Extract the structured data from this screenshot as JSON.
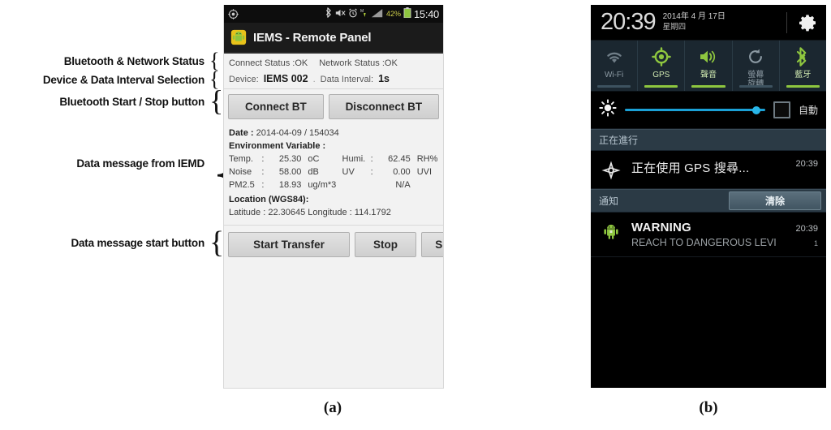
{
  "figure": {
    "caption_a": "(a)",
    "caption_b": "(b)"
  },
  "annotations": [
    {
      "id": "bt-network-status",
      "text": "Bluetooth & Network Status"
    },
    {
      "id": "device-interval",
      "text": "Device & Data Interval Selection"
    },
    {
      "id": "bt-start-stop",
      "text": "Bluetooth Start / Stop button"
    },
    {
      "id": "data-message",
      "text": "Data message from IEMD"
    },
    {
      "id": "data-start-button",
      "text": "Data message start button"
    }
  ],
  "panel_a": {
    "status_bar": {
      "icons": [
        "gps-icon",
        "bluetooth-icon",
        "mute-icon",
        "alarm-icon",
        "sync-icon",
        "signal-icon"
      ],
      "battery_percent": "42%",
      "clock": "15:40"
    },
    "action_bar": {
      "app_icon": "android-robot-icon",
      "title": "IEMS - Remote Panel"
    },
    "status_row": {
      "connect_status": "Connect Status :OK",
      "network_status": "Network Status :OK"
    },
    "device_row": {
      "device_label": "Device:",
      "device_value": "IEMS 002",
      "separator": ".",
      "interval_label": "Data Interval:",
      "interval_value": "1s"
    },
    "bt_buttons": {
      "connect": "Connect BT",
      "disconnect": "Disconnect BT"
    },
    "data_message": {
      "date_label": "Date :",
      "date_value": "2014-04-09 / 154034",
      "env_label": "Environment Variable :",
      "rows": [
        {
          "name": "Temp.",
          "colon": ":",
          "value": "25.30",
          "unit": "oC",
          "name2": "Humi. ",
          "colon2": ":",
          "value2": "62.45",
          "unit2": "RH%"
        },
        {
          "name": "Noise",
          "colon": ":",
          "value": "58.00",
          "unit": "dB",
          "name2": "UV",
          "colon2": ":",
          "value2": "0.00",
          "unit2": "UVI"
        },
        {
          "name": "PM2.5",
          "colon": ":",
          "value": "18.93",
          "unit": "ug/m*3",
          "name2": "",
          "colon2": "",
          "value2": "N/A",
          "unit2": ""
        }
      ],
      "location_label": "Location (WGS84):",
      "lat_label": "Latitude :",
      "lat_value": "22.30645",
      "lon_label": "Longitude :",
      "lon_value": "114.1792"
    },
    "transfer_buttons": {
      "start": "Start Transfer",
      "stop": "Stop",
      "send": "SEND"
    }
  },
  "panel_b": {
    "header": {
      "time": "20:39",
      "date": "2014年 4 月 17日",
      "weekday": "星期四",
      "settings_icon": "gear-icon"
    },
    "toggles": [
      {
        "icon": "wifi-icon",
        "label": "Wi-Fi",
        "state": "off"
      },
      {
        "icon": "gps-icon",
        "label": "GPS",
        "state": "on"
      },
      {
        "icon": "volume-icon",
        "label": "聲音",
        "state": "on"
      },
      {
        "icon": "rotate-icon",
        "label": "螢幕\n旋轉",
        "state": "off"
      },
      {
        "icon": "bluetooth-icon",
        "label": "藍牙",
        "state": "on"
      }
    ],
    "brightness": {
      "icon": "brightness-icon",
      "auto_label": "自動",
      "auto_checked": false,
      "level_percent": 92
    },
    "ongoing": {
      "section_title": "正在進行",
      "item": {
        "icon": "gps-target-icon",
        "title": "正在使用 GPS 搜尋...",
        "time": "20:39"
      }
    },
    "notifications": {
      "section_title": "通知",
      "clear_label": "清除",
      "item": {
        "icon": "android-robot-icon",
        "title": "WARNING",
        "subtitle": "REACH TO DANGEROUS LEVI",
        "time": "20:39",
        "count": "1"
      }
    }
  },
  "colors": {
    "android_green": "#8ec63f",
    "slider_blue": "#1ba1d6",
    "shade_panel": "#1b2730",
    "section_header": "#2b3a45"
  }
}
